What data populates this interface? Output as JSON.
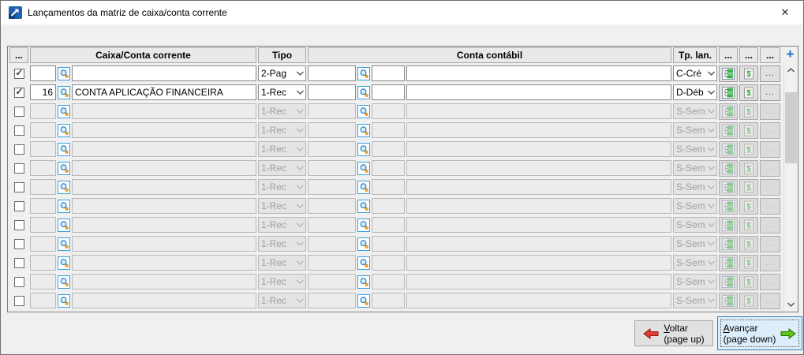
{
  "window": {
    "title": "Lançamentos da matriz de caixa/conta corrente",
    "close_glyph": "✕"
  },
  "grid": {
    "headers": {
      "select": "...",
      "caixa": "Caixa/Conta corrente",
      "tipo": "Tipo",
      "conta": "Conta contábil",
      "tp_lan": "Tp. lan.",
      "extra1": "...",
      "extra2": "...",
      "extra3": "...",
      "add_glyph": "+"
    },
    "dots_label": "...",
    "rows": [
      {
        "checked": true,
        "enabled": true,
        "caixa_code": "",
        "caixa_name": "",
        "tipo": "2-Pag",
        "conta_code": "",
        "conta_reduzido": "",
        "conta_name": "",
        "tp_lan": "C-Cré"
      },
      {
        "checked": true,
        "enabled": true,
        "caixa_code": "16",
        "caixa_name": "CONTA APLICAÇÃO FINANCEIRA",
        "tipo": "1-Rec",
        "conta_code": "",
        "conta_reduzido": "",
        "conta_name": "",
        "tp_lan": "D-Déb"
      },
      {
        "checked": false,
        "enabled": false,
        "caixa_code": "",
        "caixa_name": "",
        "tipo": "1-Rec",
        "conta_code": "",
        "conta_reduzido": "",
        "conta_name": "",
        "tp_lan": "S-Sem"
      },
      {
        "checked": false,
        "enabled": false,
        "caixa_code": "",
        "caixa_name": "",
        "tipo": "1-Rec",
        "conta_code": "",
        "conta_reduzido": "",
        "conta_name": "",
        "tp_lan": "S-Sem"
      },
      {
        "checked": false,
        "enabled": false,
        "caixa_code": "",
        "caixa_name": "",
        "tipo": "1-Rec",
        "conta_code": "",
        "conta_reduzido": "",
        "conta_name": "",
        "tp_lan": "S-Sem"
      },
      {
        "checked": false,
        "enabled": false,
        "caixa_code": "",
        "caixa_name": "",
        "tipo": "1-Rec",
        "conta_code": "",
        "conta_reduzido": "",
        "conta_name": "",
        "tp_lan": "S-Sem"
      },
      {
        "checked": false,
        "enabled": false,
        "caixa_code": "",
        "caixa_name": "",
        "tipo": "1-Rec",
        "conta_code": "",
        "conta_reduzido": "",
        "conta_name": "",
        "tp_lan": "S-Sem"
      },
      {
        "checked": false,
        "enabled": false,
        "caixa_code": "",
        "caixa_name": "",
        "tipo": "1-Rec",
        "conta_code": "",
        "conta_reduzido": "",
        "conta_name": "",
        "tp_lan": "S-Sem"
      },
      {
        "checked": false,
        "enabled": false,
        "caixa_code": "",
        "caixa_name": "",
        "tipo": "1-Rec",
        "conta_code": "",
        "conta_reduzido": "",
        "conta_name": "",
        "tp_lan": "S-Sem"
      },
      {
        "checked": false,
        "enabled": false,
        "caixa_code": "",
        "caixa_name": "",
        "tipo": "1-Rec",
        "conta_code": "",
        "conta_reduzido": "",
        "conta_name": "",
        "tp_lan": "S-Sem"
      },
      {
        "checked": false,
        "enabled": false,
        "caixa_code": "",
        "caixa_name": "",
        "tipo": "1-Rec",
        "conta_code": "",
        "conta_reduzido": "",
        "conta_name": "",
        "tp_lan": "S-Sem"
      },
      {
        "checked": false,
        "enabled": false,
        "caixa_code": "",
        "caixa_name": "",
        "tipo": "1-Rec",
        "conta_code": "",
        "conta_reduzido": "",
        "conta_name": "",
        "tp_lan": "S-Sem"
      },
      {
        "checked": false,
        "enabled": false,
        "caixa_code": "",
        "caixa_name": "",
        "tipo": "1-Rec",
        "conta_code": "",
        "conta_reduzido": "",
        "conta_name": "",
        "tp_lan": "S-Sem"
      }
    ]
  },
  "footer": {
    "voltar_label": "Voltar",
    "voltar_sub": "(page up)",
    "avancar_label": "Avançar",
    "avancar_sub": "(page down)"
  },
  "colors": {
    "accent_blue": "#1f6fd0",
    "lookup_border": "#35a0e0",
    "tree_green": "#3fbf4f",
    "money_green": "#1f9e3a",
    "red_arrow": "#e23a2e",
    "green_arrow": "#5ec610",
    "header_bg": "#e9e9e9"
  }
}
